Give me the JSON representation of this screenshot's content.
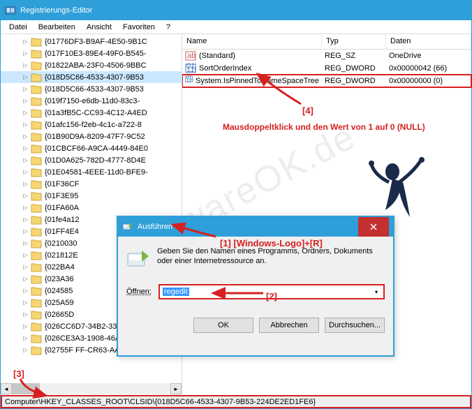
{
  "window": {
    "title": "Registrierungs-Editor"
  },
  "menu": {
    "file": "Datei",
    "edit": "Bearbeiten",
    "view": "Ansicht",
    "favorites": "Favoriten",
    "help": "?"
  },
  "tree": {
    "items": [
      "{01776DF3-B9AF-4E50-9B1C",
      "{017F10E3-89E4-49F0-B545-",
      "{01822ABA-23F0-4506-9BBC",
      "{018D5C66-4533-4307-9B53",
      "{018D5C66-4533-4307-9B53",
      "{019f7150-e6db-11d0-83c3-",
      "{01a3fB5C-CC93-4C12-A4ED",
      "{01afc156-f2eb-4c1c-a722-8",
      "{01B90D9A-8209-47F7-9C52",
      "{01CBCF66-A9CA-4449-84E0",
      "{01D0A625-782D-4777-8D4E",
      "{01E04581-4EEE-11d0-BFE9-",
      "{01F36CF",
      "{01F3E95",
      "{01FA60A",
      "{01fe4a12",
      "{01FF4E4",
      "{0210030",
      "{021812E",
      "{022BA4",
      "{023A36",
      "{024585",
      "{025A59",
      "{02665D",
      "{026CC6D7-34B2-33D5-B55",
      "{026CE3A3-1908-46AA-1988",
      "{02755F FF-CR63-AAAA-R20A"
    ],
    "selected_index": 3
  },
  "list": {
    "headers": {
      "name": "Name",
      "type": "Typ",
      "data": "Daten"
    },
    "rows": [
      {
        "icon": "sz",
        "name": "(Standard)",
        "type": "REG_SZ",
        "data": "OneDrive"
      },
      {
        "icon": "dw",
        "name": "SortOrderIndex",
        "type": "REG_DWORD",
        "data": "0x00000042 (66)"
      },
      {
        "icon": "dw",
        "name": "System.IsPinnedToNameSpaceTree",
        "type": "REG_DWORD",
        "data": "0x00000000 (0)",
        "hl": true
      }
    ]
  },
  "status": {
    "path": "Computer\\HKEY_CLASSES_ROOT\\CLSID\\{018D5C66-4533-4307-9B53-224DE2ED1FE6}"
  },
  "run": {
    "title": "Ausführen",
    "desc": "Geben Sie den Namen eines Programms, Ordners, Dokuments oder einer Internetressource an.",
    "open_label": "Öffnen:",
    "value": "regedit",
    "ok": "OK",
    "cancel": "Abbrechen",
    "browse": "Durchsuchen..."
  },
  "annotations": {
    "a1": "[1]  [Windows-Logo]+[R]",
    "a2": "[2]",
    "a3": "[3]",
    "a4": "[4]",
    "a4_text": "Mausdoppeltklick und den Wert von 1 auf 0 (NULL)"
  },
  "watermark": "SoftwareOK.de"
}
